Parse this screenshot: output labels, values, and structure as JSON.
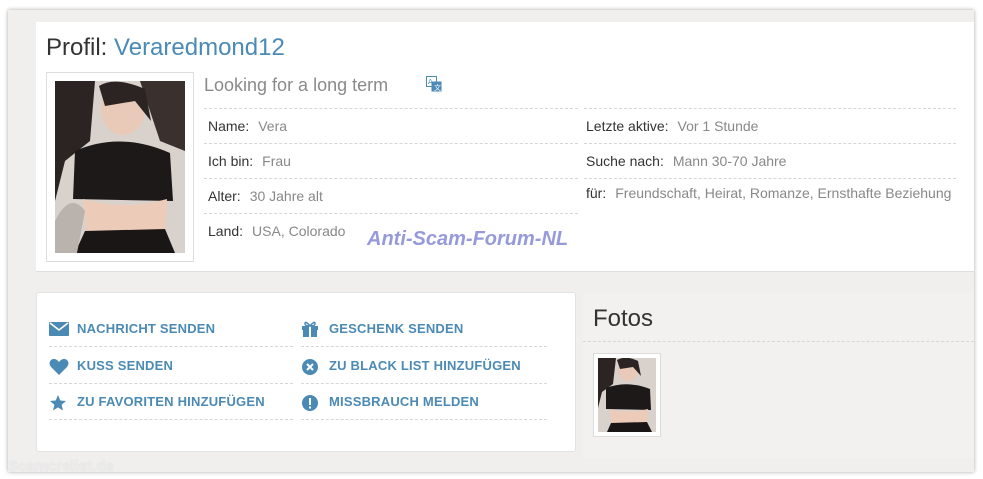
{
  "profile": {
    "title_prefix": "Profil:",
    "username": "Veraredmond12",
    "tagline": "Looking for a long term",
    "translate_icon": "translate-icon",
    "details_left": [
      {
        "label": "Name:",
        "value": "Vera"
      },
      {
        "label": "Ich bin:",
        "value": "Frau"
      },
      {
        "label": "Alter:",
        "value": "30 Jahre alt"
      },
      {
        "label": "Land:",
        "value": "USA, Colorado"
      }
    ],
    "details_right": [
      {
        "label": "Letzte aktive:",
        "value": "Vor 1 Stunde"
      },
      {
        "label": "Suche nach:",
        "value": "Mann 30-70 Jahre"
      },
      {
        "label": "für:",
        "value": "Freundschaft, Heirat, Romanze, Ernsthafte Beziehung"
      }
    ]
  },
  "watermark": "Anti-Scam-Forum-NL",
  "actions": [
    {
      "label": "NACHRICHT SENDEN",
      "icon": "envelope-icon"
    },
    {
      "label": "GESCHENK SENDEN",
      "icon": "gift-icon"
    },
    {
      "label": "KUSS SENDEN",
      "icon": "heart-icon"
    },
    {
      "label": "ZU BLACK LIST HINZUFÜGEN",
      "icon": "x-circle-icon"
    },
    {
      "label": "ZU FAVORITEN HINZUFÜGEN",
      "icon": "star-icon"
    },
    {
      "label": "MISSBRAUCH MELDEN",
      "icon": "alert-circle-icon"
    }
  ],
  "fotos": {
    "title": "Fotos"
  },
  "footer_mark": "Scamcrelist.de",
  "colors": {
    "accent": "#4b8ab5",
    "watermark": "#8b90d8"
  }
}
